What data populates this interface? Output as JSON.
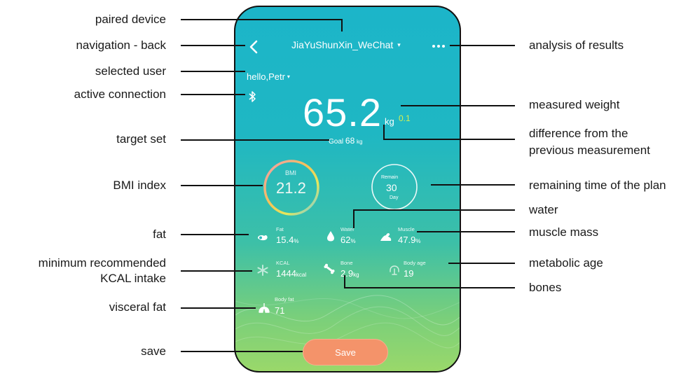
{
  "header": {
    "device_name": "JiaYuShunXin_WeChat",
    "device_caret": "▾",
    "user_greeting": "hello,Petr",
    "user_caret": "▾"
  },
  "measurement": {
    "weight": "65.2",
    "weight_unit": "kg",
    "difference": "0.1",
    "goal_label": "Goal",
    "goal_value": "68",
    "goal_unit": "kg"
  },
  "bmi": {
    "label": "BMI",
    "value": "21.2"
  },
  "remain": {
    "label": "Remain",
    "value": "30",
    "unit": "Day"
  },
  "metrics": [
    {
      "title": "Fat",
      "value": "15.4",
      "unit": "%"
    },
    {
      "title": "Water",
      "value": "62",
      "unit": "%"
    },
    {
      "title": "Muscle",
      "value": "47.9",
      "unit": "%"
    },
    {
      "title": "KCAL",
      "value": "1444",
      "unit": "kcal"
    },
    {
      "title": "Bone",
      "value": "2.9",
      "unit": "kg"
    },
    {
      "title": "Body age",
      "value": "19",
      "unit": ""
    },
    {
      "title": "Body fat",
      "value": "71",
      "unit": ""
    }
  ],
  "save_label": "Save",
  "annotations": {
    "paired_device": "paired device",
    "navigation_back": "navigation - back",
    "selected_user": "selected user",
    "active_connection": "active connection",
    "target_set": "target set",
    "bmi_index": "BMI index",
    "fat": "fat",
    "min_kcal_line1": "minimum recommended",
    "min_kcal_line2": "KCAL intake",
    "visceral_fat": "visceral fat",
    "save": "save",
    "analysis_of_results": "analysis of results",
    "measured_weight": "measured weight",
    "difference_line1": "difference from the",
    "difference_line2": "previous measurement",
    "remaining_time": "remaining time of the plan",
    "water": "water",
    "muscle_mass": "muscle mass",
    "metabolic_age": "metabolic age",
    "bones": "bones"
  },
  "colors": {
    "accent_save": "#f4936a",
    "difference_highlight": "#d6f051",
    "bmi_ring_gradient": [
      "#f19bb0",
      "#f6c455",
      "#e5e85c",
      "#6ec6e8"
    ]
  },
  "icons": [
    "back-chevron-icon",
    "more-dots-icon",
    "bluetooth-icon",
    "fat-icon",
    "water-drop-icon",
    "muscle-arm-icon",
    "kcal-asterisk-icon",
    "bone-icon",
    "body-age-icon",
    "visceral-fat-icon"
  ]
}
